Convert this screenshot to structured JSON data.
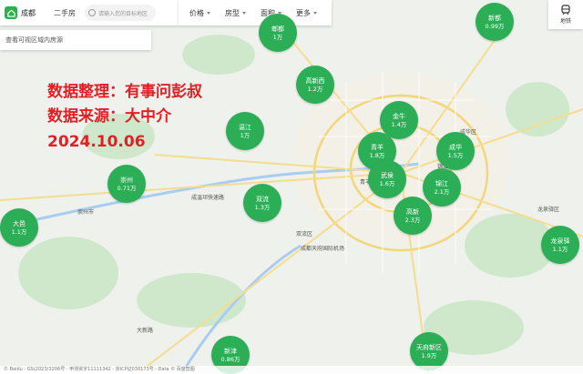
{
  "header": {
    "city": "成都",
    "tab_secondhand": "二手房",
    "search_placeholder": "请输入您的目标地区"
  },
  "filters": [
    "价格",
    "房型",
    "面积",
    "更多"
  ],
  "hint_text": "查看可视区域内房源",
  "subway_label": "地铁",
  "watermark": {
    "line1": "数据整理：有事问彭叔",
    "line2": "数据来源：大中介",
    "line3": "2024.10.06"
  },
  "districts": [
    {
      "name": "郫都",
      "price": "1万"
    },
    {
      "name": "新都",
      "price": "0.99万"
    },
    {
      "name": "高新西",
      "price": "1.2万"
    },
    {
      "name": "金牛",
      "price": "1.4万"
    },
    {
      "name": "温江",
      "price": "1万"
    },
    {
      "name": "青羊",
      "price": "1.8万"
    },
    {
      "name": "成华",
      "price": "1.5万"
    },
    {
      "name": "武侯",
      "price": "1.6万"
    },
    {
      "name": "崇州",
      "price": "0.71万"
    },
    {
      "name": "双流",
      "price": "1.3万"
    },
    {
      "name": "锦江",
      "price": "2.1万"
    },
    {
      "name": "高新",
      "price": "2.3万"
    },
    {
      "name": "大邑",
      "price": "1.1万"
    },
    {
      "name": "龙泉驿",
      "price": "1.1万"
    },
    {
      "name": "新津",
      "price": "0.86万"
    },
    {
      "name": "天府新区",
      "price": "1.9万"
    }
  ],
  "map_labels": [
    "青羊区",
    "成华区",
    "双流区",
    "锦江区",
    "龙泉驿区",
    "大新路",
    "崇州市",
    "成温邛快速路",
    "成都天府国际机场"
  ],
  "footer": "© Baidu - GS(2023)3206号 - 甲测资字11111342 - 京ICP证030173号 - Data © 百度智图"
}
